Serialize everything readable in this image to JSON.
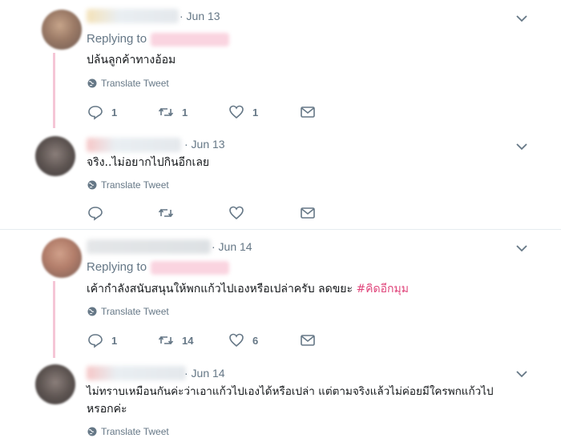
{
  "tweets": [
    {
      "date": "· Jun 13",
      "replying_to": "Replying to",
      "text": "ปล้นลูกค้าทางอ้อม",
      "translate": "Translate Tweet",
      "replies": "1",
      "retweets": "1",
      "likes": "1"
    },
    {
      "date": "· Jun 13",
      "text": "จริง..ไม่อยากไปกินอีกเลย",
      "translate": "Translate Tweet",
      "replies": "",
      "retweets": "",
      "likes": ""
    },
    {
      "date": "· Jun 14",
      "replying_to": "Replying to",
      "text": "เค้ากำลังสนับสนุนให้พกแก้วไปเองหรือเปล่าครับ ลดขยะ",
      "hashtag": "#คิดอีกมุม",
      "translate": "Translate Tweet",
      "replies": "1",
      "retweets": "14",
      "likes": "6"
    },
    {
      "date": "· Jun 14",
      "text_line1": "ไม่ทราบเหมือนกันค่ะว่าเอาแก้วไปเองได้หรือเปล่า แต่ตามจริงแล้วไม่ค่อยมีใครพกแก้วไป",
      "text_line2": "หรอกค่ะ",
      "translate": "Translate Tweet"
    }
  ],
  "icons": {
    "reply": "reply-icon",
    "retweet": "retweet-icon",
    "like": "heart-icon",
    "message": "envelope-icon",
    "globe": "globe-icon",
    "caret": "chevron-down-icon"
  },
  "colors": {
    "thread_line": "#f5c6d6",
    "muted_text": "#657786",
    "hashtag": "#e0457b"
  }
}
